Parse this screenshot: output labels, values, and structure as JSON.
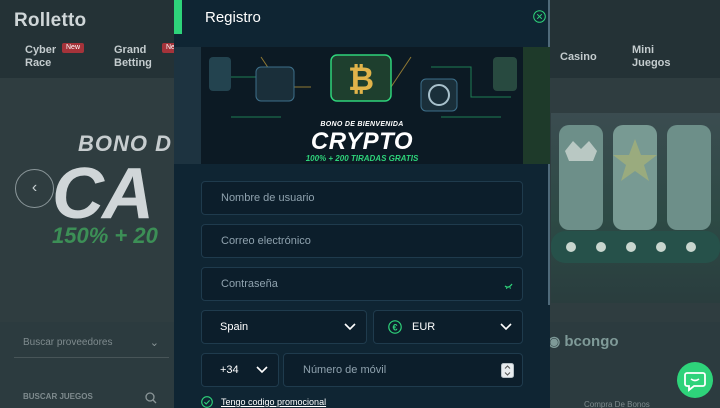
{
  "background": {
    "logo": "Rolletto",
    "nav": [
      {
        "label_line1": "Cyber",
        "label_line2": "Race",
        "badge": "New"
      },
      {
        "label_line1": "Grand",
        "label_line2": "Betting",
        "badge": "Ne"
      },
      {
        "label_line1": "Casino",
        "label_line2": ""
      },
      {
        "label_line1": "Mini",
        "label_line2": "Juegos"
      }
    ],
    "hero": {
      "small_text": "BONO D",
      "big_text": "CA",
      "green_text": "150% + 20"
    },
    "provider_filter": "Buscar proveedores",
    "search_games": "BUSCAR JUEGOS",
    "provider_logo": "bcongo",
    "compra_label": "Compra De Bonos"
  },
  "modal": {
    "title": "Registro",
    "banner": {
      "subtitle": "BONO DE BIENVENIDA",
      "title": "CRYPTO",
      "offer": "100% + 200 TIRADAS GRATIS"
    },
    "fields": {
      "username_placeholder": "Nombre de usuario",
      "email_placeholder": "Correo electrónico",
      "password_placeholder": "Contraseña",
      "country": "Spain",
      "currency": "EUR",
      "phone_code": "+34",
      "phone_placeholder": "Número de móvil"
    },
    "promo_label": "Tengo codigo promocional"
  },
  "colors": {
    "accent": "#2ed37a",
    "modal_bg": "#0f2533",
    "field_bg": "#0c1e2b",
    "field_border": "#1f3b4d"
  }
}
